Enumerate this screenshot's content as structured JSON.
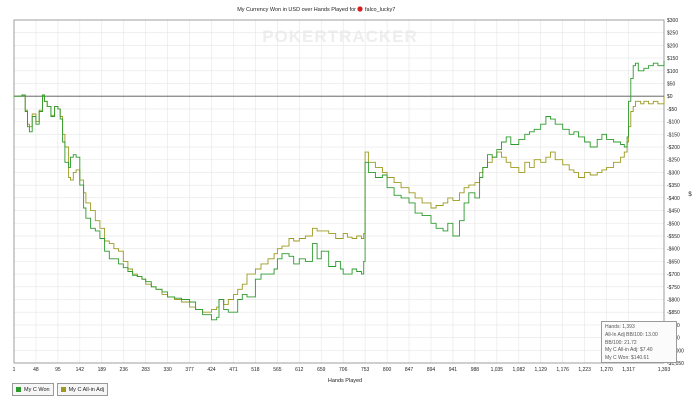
{
  "title": {
    "prefix": "My Currency Won in USD over Hands Played for",
    "player": "falco_lucky7"
  },
  "watermark": "POKERTRACKER",
  "xlabel": "Hands Played",
  "ylabel": "$",
  "legend": [
    {
      "label": "My C Won",
      "color": "#2e9a2e"
    },
    {
      "label": "My C All-in Adj",
      "color": "#9c9a20"
    }
  ],
  "stats": [
    "Hands: 1,393",
    "All-In Adj BB/100: 13.00",
    "BB/100: 21.72",
    "My C All-in Adj: $7.40",
    "My C Won: $140.61"
  ],
  "chart_data": {
    "type": "line",
    "title": "My Currency Won in USD over Hands Played for falco_lucky7",
    "xlabel": "Hands Played",
    "ylabel": "$",
    "xlim": [
      1,
      1393
    ],
    "ylim": [
      -1050,
      300
    ],
    "x_ticks": [
      1,
      48,
      95,
      142,
      189,
      236,
      283,
      330,
      377,
      424,
      471,
      518,
      565,
      612,
      659,
      706,
      753,
      800,
      847,
      894,
      941,
      988,
      1035,
      1082,
      1129,
      1176,
      1223,
      1270,
      1317,
      1393
    ],
    "x_tick_labels": [
      "1",
      "48",
      "95",
      "142",
      "189",
      "236",
      "283",
      "330",
      "377",
      "424",
      "471",
      "518",
      "565",
      "612",
      "659",
      "706",
      "753",
      "800",
      "847",
      "894",
      "941",
      "988",
      "1,035",
      "1,082",
      "1,129",
      "1,176",
      "1,223",
      "1,270",
      "1,317",
      "1,393"
    ],
    "y_ticks": [
      300,
      250,
      200,
      150,
      100,
      50,
      0,
      -50,
      -100,
      -150,
      -200,
      -250,
      -300,
      -350,
      -400,
      -450,
      -500,
      -550,
      -600,
      -650,
      -700,
      -750,
      -800,
      -850,
      -900,
      -950,
      -1000,
      -1050
    ],
    "y_tick_labels": [
      "$300",
      "$250",
      "$200",
      "$150",
      "$100",
      "$50",
      "$0",
      "-$50",
      "-$100",
      "-$150",
      "-$200",
      "-$250",
      "-$300",
      "-$350",
      "-$400",
      "-$450",
      "-$500",
      "-$550",
      "-$600",
      "-$650",
      "-$700",
      "-$750",
      "-$800",
      "-$850",
      "-$900",
      "-$950",
      "-$1,000",
      "-$1,050"
    ],
    "zero_line": 0,
    "grid": true,
    "legend_position": "bottom-left",
    "series": [
      {
        "name": "My C Won",
        "color": "#2e9a2e",
        "x": [
          1,
          10,
          18,
          25,
          30,
          34,
          40,
          48,
          55,
          62,
          66,
          72,
          80,
          88,
          95,
          100,
          105,
          110,
          118,
          122,
          128,
          134,
          142,
          150,
          155,
          165,
          175,
          185,
          195,
          205,
          215,
          225,
          235,
          245,
          255,
          265,
          275,
          283,
          295,
          305,
          318,
          330,
          345,
          360,
          377,
          390,
          405,
          424,
          435,
          440,
          450,
          460,
          471,
          480,
          490,
          500,
          518,
          530,
          545,
          558,
          565,
          575,
          590,
          600,
          612,
          625,
          640,
          650,
          659,
          675,
          690,
          700,
          706,
          715,
          725,
          735,
          745,
          750,
          753,
          760,
          775,
          790,
          800,
          815,
          830,
          847,
          860,
          875,
          894,
          905,
          920,
          930,
          941,
          955,
          965,
          975,
          988,
          998,
          1005,
          1015,
          1025,
          1035,
          1045,
          1055,
          1065,
          1082,
          1095,
          1105,
          1115,
          1129,
          1140,
          1150,
          1160,
          1176,
          1190,
          1200,
          1210,
          1223,
          1235,
          1250,
          1260,
          1270,
          1285,
          1300,
          1308,
          1314,
          1317,
          1322,
          1327,
          1332,
          1338,
          1343,
          1350,
          1360,
          1370,
          1380,
          1393
        ],
        "values": [
          0,
          0,
          5,
          -60,
          -120,
          -140,
          -80,
          -110,
          -60,
          5,
          -20,
          -40,
          -80,
          -40,
          -50,
          -90,
          -180,
          -260,
          -280,
          -240,
          -230,
          -240,
          -350,
          -440,
          -480,
          -520,
          -530,
          -560,
          -610,
          -640,
          -640,
          -660,
          -675,
          -690,
          -705,
          -710,
          -720,
          -730,
          -750,
          -760,
          -770,
          -790,
          -795,
          -800,
          -810,
          -840,
          -860,
          -880,
          -870,
          -800,
          -840,
          -850,
          -850,
          -800,
          -780,
          -790,
          -720,
          -700,
          -700,
          -680,
          -640,
          -620,
          -630,
          -660,
          -640,
          -650,
          -580,
          -640,
          -610,
          -670,
          -650,
          -680,
          -700,
          -700,
          -680,
          -690,
          -700,
          -650,
          -260,
          -300,
          -320,
          -310,
          -360,
          -390,
          -400,
          -420,
          -460,
          -470,
          -500,
          -520,
          -530,
          -500,
          -550,
          -490,
          -420,
          -380,
          -400,
          -320,
          -280,
          -230,
          -240,
          -210,
          -180,
          -160,
          -190,
          -170,
          -150,
          -140,
          -130,
          -110,
          -80,
          -90,
          -110,
          -130,
          -150,
          -140,
          -160,
          -180,
          -200,
          -170,
          -150,
          -170,
          -180,
          -190,
          -200,
          -160,
          -20,
          70,
          120,
          130,
          100,
          100,
          110,
          120,
          130,
          120,
          140
        ]
      },
      {
        "name": "My C All-in Adj",
        "color": "#9c9a20",
        "x": [
          1,
          10,
          18,
          25,
          30,
          34,
          40,
          48,
          55,
          62,
          66,
          72,
          80,
          88,
          95,
          100,
          105,
          110,
          118,
          122,
          128,
          134,
          142,
          150,
          155,
          165,
          175,
          185,
          195,
          205,
          215,
          225,
          235,
          245,
          255,
          265,
          275,
          283,
          295,
          305,
          318,
          330,
          345,
          360,
          377,
          390,
          405,
          424,
          435,
          440,
          450,
          460,
          471,
          480,
          490,
          500,
          518,
          530,
          545,
          558,
          565,
          575,
          590,
          600,
          612,
          625,
          640,
          650,
          659,
          675,
          690,
          700,
          706,
          715,
          725,
          735,
          745,
          750,
          753,
          760,
          775,
          790,
          800,
          815,
          830,
          847,
          860,
          875,
          894,
          905,
          920,
          930,
          941,
          955,
          965,
          975,
          988,
          998,
          1005,
          1015,
          1025,
          1035,
          1045,
          1055,
          1065,
          1082,
          1095,
          1105,
          1115,
          1129,
          1140,
          1150,
          1160,
          1176,
          1190,
          1200,
          1210,
          1223,
          1235,
          1250,
          1260,
          1270,
          1285,
          1300,
          1308,
          1314,
          1317,
          1322,
          1327,
          1332,
          1338,
          1343,
          1350,
          1360,
          1370,
          1380,
          1393
        ],
        "values": [
          0,
          0,
          5,
          -55,
          -110,
          -120,
          -70,
          -100,
          -55,
          5,
          -20,
          -40,
          -75,
          -40,
          -50,
          -80,
          -150,
          -200,
          -320,
          -330,
          -300,
          -290,
          -330,
          -380,
          -420,
          -450,
          -490,
          -520,
          -570,
          -580,
          -600,
          -610,
          -650,
          -680,
          -700,
          -710,
          -720,
          -740,
          -750,
          -760,
          -780,
          -790,
          -800,
          -810,
          -830,
          -840,
          -850,
          -840,
          -830,
          -800,
          -820,
          -800,
          -780,
          -760,
          -740,
          -700,
          -680,
          -660,
          -640,
          -620,
          -600,
          -590,
          -560,
          -570,
          -560,
          -550,
          -520,
          -530,
          -530,
          -540,
          -560,
          -560,
          -540,
          -555,
          -560,
          -550,
          -560,
          -540,
          -220,
          -260,
          -280,
          -300,
          -320,
          -340,
          -360,
          -380,
          -400,
          -420,
          -440,
          -430,
          -420,
          -400,
          -410,
          -380,
          -360,
          -350,
          -340,
          -300,
          -280,
          -260,
          -240,
          -220,
          -240,
          -260,
          -280,
          -300,
          -260,
          -280,
          -250,
          -260,
          -240,
          -220,
          -250,
          -270,
          -290,
          -300,
          -320,
          -300,
          -310,
          -300,
          -290,
          -280,
          -260,
          -240,
          -220,
          -180,
          -120,
          -60,
          -40,
          -20,
          -20,
          -30,
          -20,
          -30,
          -20,
          -30,
          0
        ]
      }
    ]
  }
}
